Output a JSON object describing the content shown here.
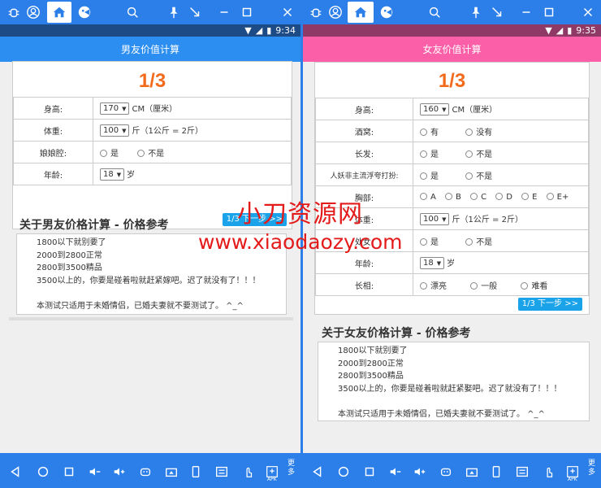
{
  "top_bar": {
    "left_panel_buttons": [
      "bug-icon",
      "user-icon",
      "home-icon",
      "game-icon",
      "search-icon",
      "pin-icon",
      "collapse-icon",
      "minimize-icon",
      "maximize-icon",
      "close-icon"
    ]
  },
  "left": {
    "time": "9:34",
    "header_title": "男友价值计算",
    "step": "1/3",
    "rows": [
      {
        "label": "身高:",
        "select": "170",
        "unit": "CM（厘米）"
      },
      {
        "label": "体重:",
        "select": "100",
        "unit": "斤（1公斤 = 2斤）"
      },
      {
        "label": "娘娘腔:",
        "options": [
          "是",
          "不是"
        ]
      },
      {
        "label": "年龄:",
        "select": "18",
        "unit": "岁"
      }
    ],
    "next_button": "1/3 下一步 >>",
    "ref_title": "关于男友价格计算 - 价格参考",
    "ref_lines": [
      "1800以下就别要了",
      "2000到2800正常",
      "2800到3500精品",
      "3500以上的，你要是碰着啦就赶紧嫁吧。迟了就没有了！！！",
      "",
      "本测试只适用于未婚情侣，已婚夫妻就不要测试了。 ^_^"
    ]
  },
  "right": {
    "time": "9:35",
    "header_title": "女友价值计算",
    "step": "1/3",
    "rows": [
      {
        "label": "身高:",
        "select": "160",
        "unit": "CM（厘米）"
      },
      {
        "label": "酒窝:",
        "options": [
          "有",
          "没有"
        ]
      },
      {
        "label": "长发:",
        "options": [
          "是",
          "不是"
        ]
      },
      {
        "label": "人妖非主流浮夸打扮:",
        "options": [
          "是",
          "不是"
        ]
      },
      {
        "label": "胸部:",
        "options": [
          "A",
          "B",
          "C",
          "D",
          "E",
          "E+"
        ]
      },
      {
        "label": "体重:",
        "select": "100",
        "unit": "斤（1公斤 = 2斤）"
      },
      {
        "label": "处女:",
        "options": [
          "是",
          "不是"
        ]
      },
      {
        "label": "年龄:",
        "select": "18",
        "unit": "岁"
      },
      {
        "label": "长相:",
        "options": [
          "漂亮",
          "一般",
          "难看"
        ]
      }
    ],
    "next_button": "1/3 下一步 >>",
    "ref_title": "关于女友价格计算 - 价格参考",
    "ref_lines": [
      "1800以下就别要了",
      "2000到2800正常",
      "2800到3500精品",
      "3500以上的，你要是碰着啦就赶紧娶吧。迟了就没有了！！！",
      "",
      "本测试只适用于未婚情侣，已婚夫妻就不要测试了。 ^_^"
    ]
  },
  "watermark": {
    "line1": "小刀资源网",
    "line2": "www.xiaodaozy.com"
  },
  "bottom_bar": {
    "more_label": "更多",
    "apk_label": "APK"
  },
  "colors": {
    "left_header": "#2c8ef0",
    "right_header": "#fb5fa8",
    "step": "#f26b1d",
    "next_button": "#1aa3e8"
  }
}
